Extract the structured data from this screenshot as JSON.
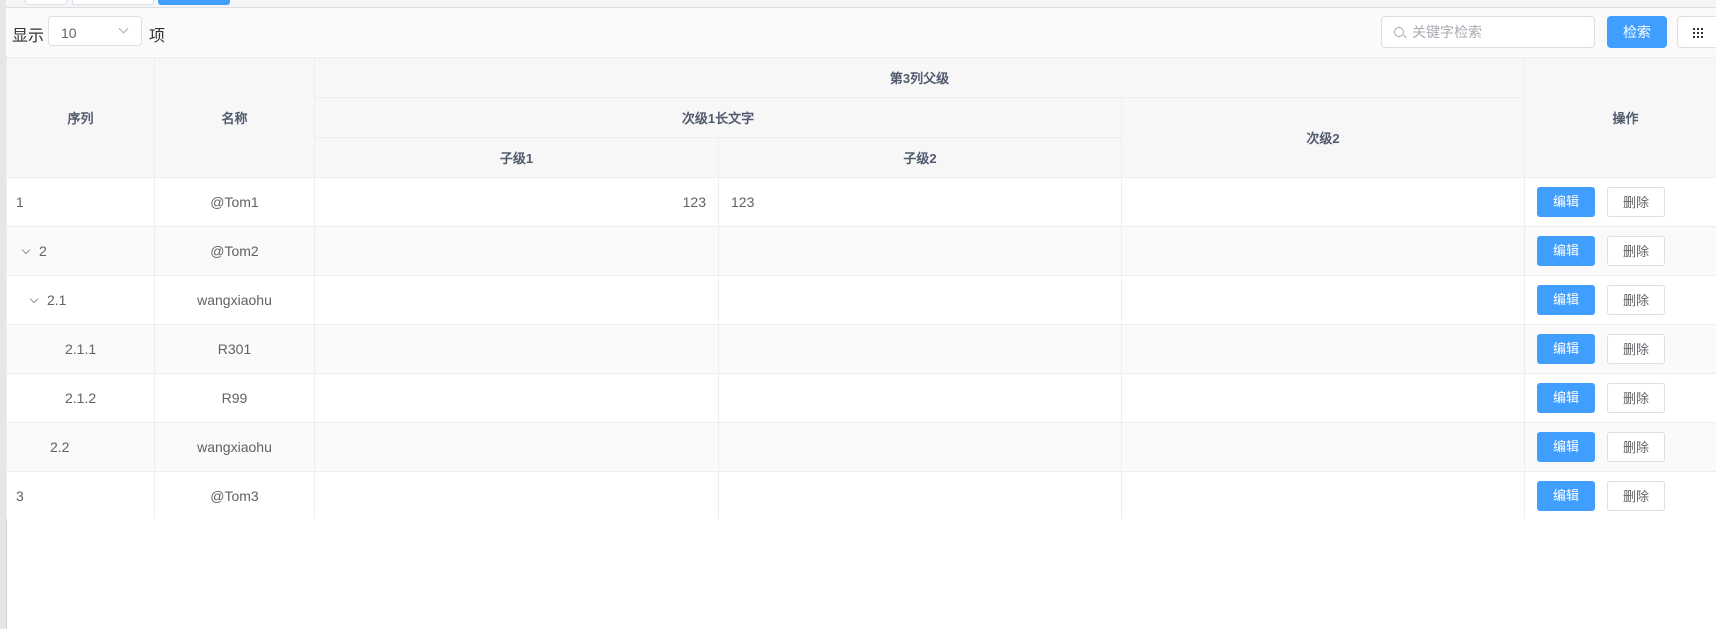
{
  "toolbar": {
    "show_label": "显示",
    "page_size": "10",
    "item_label": "项",
    "search_placeholder": "关键字检索",
    "search_button": "检索"
  },
  "table": {
    "headers": {
      "seq": "序列",
      "name": "名称",
      "group_col3": "第3列父级",
      "sub1_long": "次级1长文字",
      "sub2": "次级2",
      "child1": "子级1",
      "child2": "子级2",
      "ops": "操作"
    },
    "rows": [
      {
        "seq": "1",
        "name": "@Tom1",
        "child1": "123",
        "child2": "123",
        "sub2": ""
      },
      {
        "seq": "2",
        "name": "@Tom2",
        "child1": "",
        "child2": "",
        "sub2": ""
      },
      {
        "seq": "2.1",
        "name": "wangxiaohu",
        "child1": "",
        "child2": "",
        "sub2": ""
      },
      {
        "seq": "2.1.1",
        "name": "R301",
        "child1": "",
        "child2": "",
        "sub2": ""
      },
      {
        "seq": "2.1.2",
        "name": "R99",
        "child1": "",
        "child2": "",
        "sub2": ""
      },
      {
        "seq": "2.2",
        "name": "wangxiaohu",
        "child1": "",
        "child2": "",
        "sub2": ""
      },
      {
        "seq": "3",
        "name": "@Tom3",
        "child1": "",
        "child2": "",
        "sub2": ""
      }
    ],
    "edit_label": "编辑",
    "delete_label": "删除"
  },
  "colors": {
    "primary": "#409eff",
    "border": "#ebeef5",
    "header_bg": "#f7f7f7"
  }
}
